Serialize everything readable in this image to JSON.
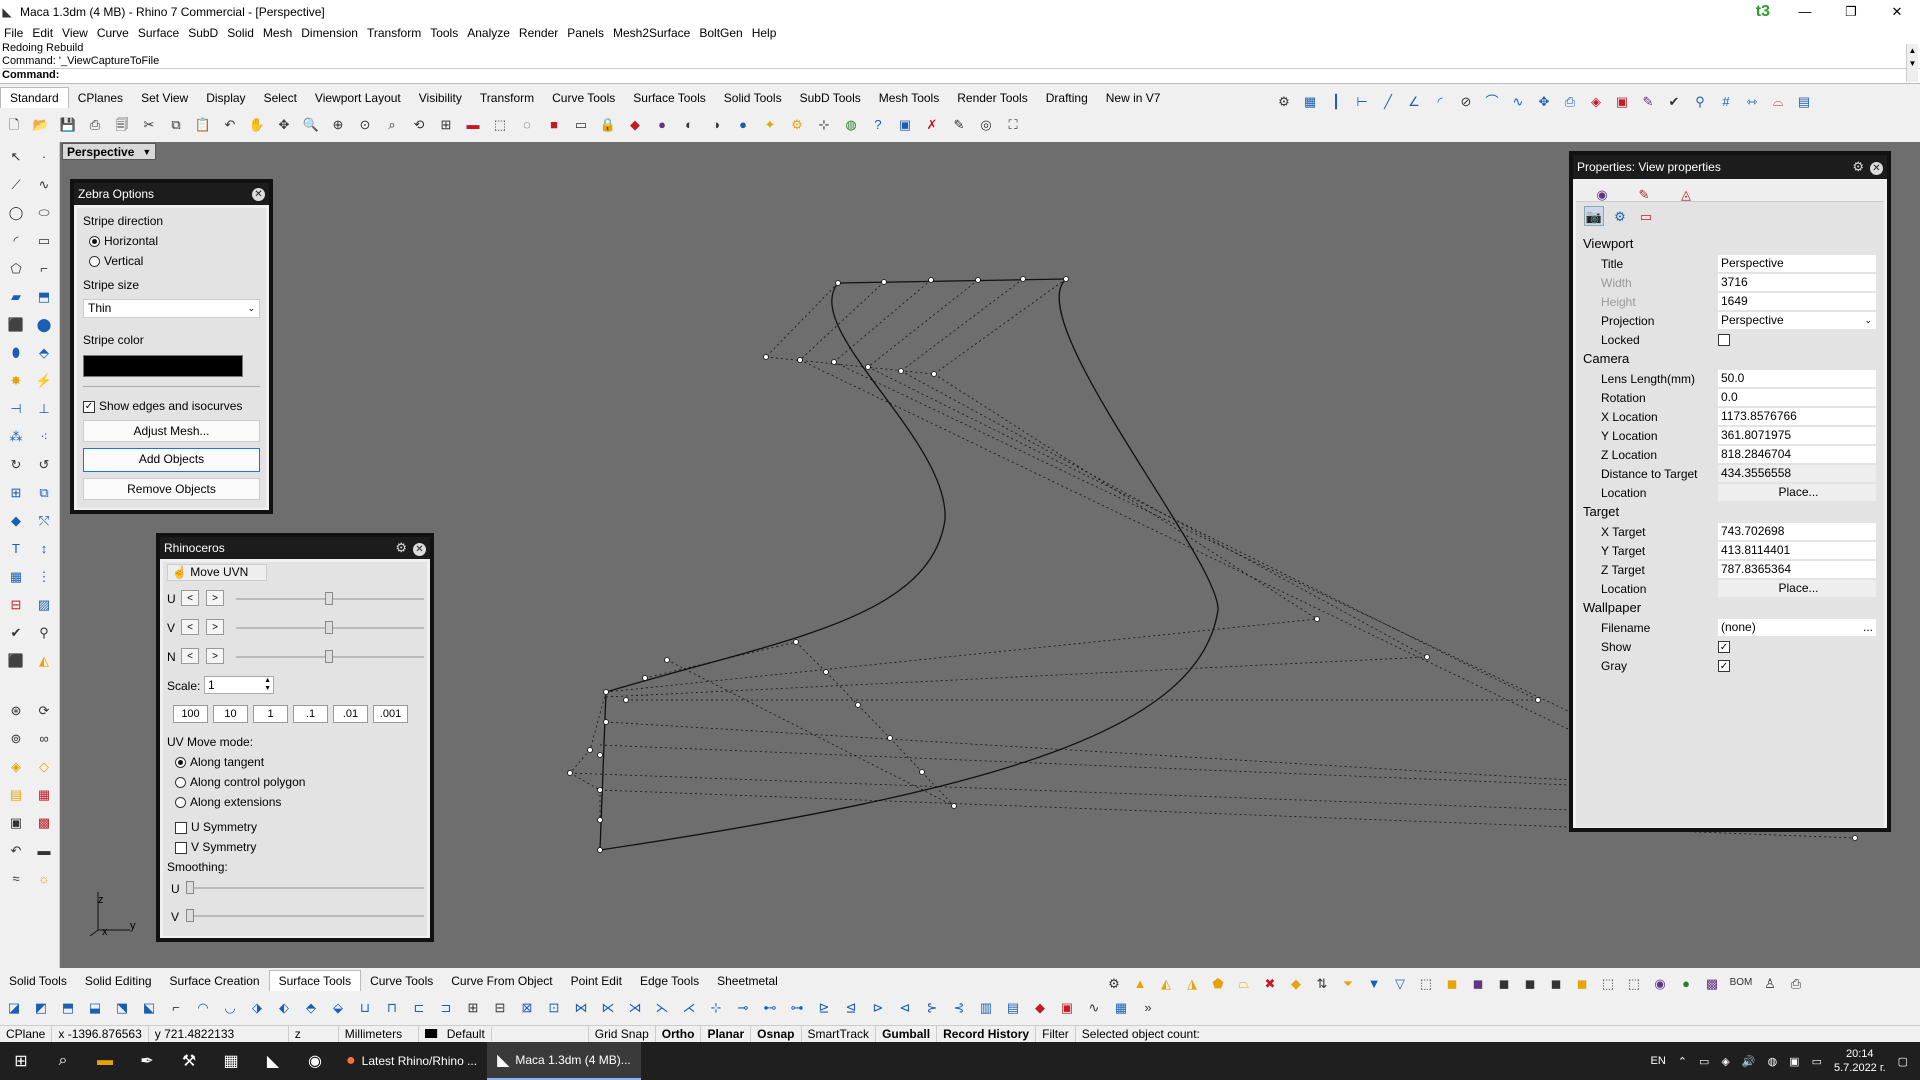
{
  "window": {
    "title": "Maca 1.3dm (4 MB) - Rhino 7 Commercial - [Perspective]",
    "buttons": [
      "—",
      "❐",
      "✕"
    ]
  },
  "menu": [
    "File",
    "Edit",
    "View",
    "Curve",
    "Surface",
    "SubD",
    "Solid",
    "Mesh",
    "Dimension",
    "Transform",
    "Tools",
    "Analyze",
    "Render",
    "Panels",
    "Mesh2Surface",
    "BoltGen",
    "Help"
  ],
  "command": {
    "history1": "Redoing Rebuild",
    "history2": "Command: '_ViewCaptureToFile",
    "prompt": "Command:"
  },
  "top_tabs": [
    "Standard",
    "CPlanes",
    "Set View",
    "Display",
    "Select",
    "Viewport Layout",
    "Visibility",
    "Transform",
    "Curve Tools",
    "Surface Tools",
    "Solid Tools",
    "SubD Tools",
    "Mesh Tools",
    "Render Tools",
    "Drafting",
    "New in V7"
  ],
  "bottom_tabs": [
    "Solid Tools",
    "Solid Editing",
    "Surface Creation",
    "Surface Tools",
    "Curve Tools",
    "Curve From Object",
    "Point Edit",
    "Edge Tools",
    "Sheetmetal"
  ],
  "viewport": {
    "label": "Perspective",
    "axis_z": "z",
    "axis_x": "x",
    "axis_y": "y"
  },
  "zebra": {
    "title": "Zebra Options",
    "stripe_direction_label": "Stripe direction",
    "horizontal": "Horizontal",
    "vertical": "Vertical",
    "stripe_size_label": "Stripe size",
    "stripe_size_value": "Thin",
    "stripe_color_label": "Stripe color",
    "stripe_color": "#000000",
    "show_edges": "Show edges and isocurves",
    "adjust_mesh": "Adjust Mesh...",
    "add_objects": "Add Objects",
    "remove_objects": "Remove Objects"
  },
  "rhino_panel": {
    "title": "Rhinoceros",
    "move_uvn": "Move UVN",
    "u": "U",
    "v": "V",
    "n": "N",
    "lt": "<",
    "gt": ">",
    "scale_label": "Scale:",
    "scale_value": "1",
    "scale_buttons": [
      "100",
      "10",
      "1",
      ".1",
      ".01",
      ".001"
    ],
    "uv_mode_label": "UV Move mode:",
    "modes": [
      "Along tangent",
      "Along control polygon",
      "Along extensions"
    ],
    "u_sym": "U Symmetry",
    "v_sym": "V Symmetry",
    "smoothing": "Smoothing:",
    "sm_u": "U",
    "sm_v": "V"
  },
  "props": {
    "title": "Properties: View properties",
    "viewport_section": "Viewport",
    "title_k": "Title",
    "title_v": "Perspective",
    "width_k": "Width",
    "width_v": "3716",
    "height_k": "Height",
    "height_v": "1649",
    "projection_k": "Projection",
    "projection_v": "Perspective",
    "locked_k": "Locked",
    "camera_section": "Camera",
    "lens_k": "Lens Length(mm)",
    "lens_v": "50.0",
    "rotation_k": "Rotation",
    "rotation_v": "0.0",
    "xloc_k": "X Location",
    "xloc_v": "1173.8576766",
    "yloc_k": "Y Location",
    "yloc_v": "361.8071975",
    "zloc_k": "Z Location",
    "zloc_v": "818.2846704",
    "dist_k": "Distance to Target",
    "dist_v": "434.3556558",
    "loc_k": "Location",
    "place": "Place...",
    "target_section": "Target",
    "xt_k": "X Target",
    "xt_v": "743.702698",
    "yt_k": "Y Target",
    "yt_v": "413.8114401",
    "zt_k": "Z Target",
    "zt_v": "787.8365364",
    "tloc_k": "Location",
    "wallpaper_section": "Wallpaper",
    "filename_k": "Filename",
    "filename_v": "(none)",
    "ellipsis": "...",
    "show_k": "Show",
    "gray_k": "Gray"
  },
  "status": {
    "cplane": "CPlane",
    "x": "x -1396.876563",
    "y": "y 721.4822133",
    "z": "z",
    "units": "Millimeters",
    "layer": "Default",
    "grid_snap": "Grid Snap",
    "ortho": "Ortho",
    "planar": "Planar",
    "osnap": "Osnap",
    "smarttrack": "SmartTrack",
    "gumball": "Gumball",
    "record_history": "Record History",
    "filter": "Filter",
    "selected": "Selected object count:"
  },
  "taskbar": {
    "app1": "Latest Rhino/Rhino ...",
    "app2": "Maca 1.3dm (4 MB)...",
    "lang": "EN",
    "time": "20:14",
    "date": "5.7.2022 г."
  }
}
